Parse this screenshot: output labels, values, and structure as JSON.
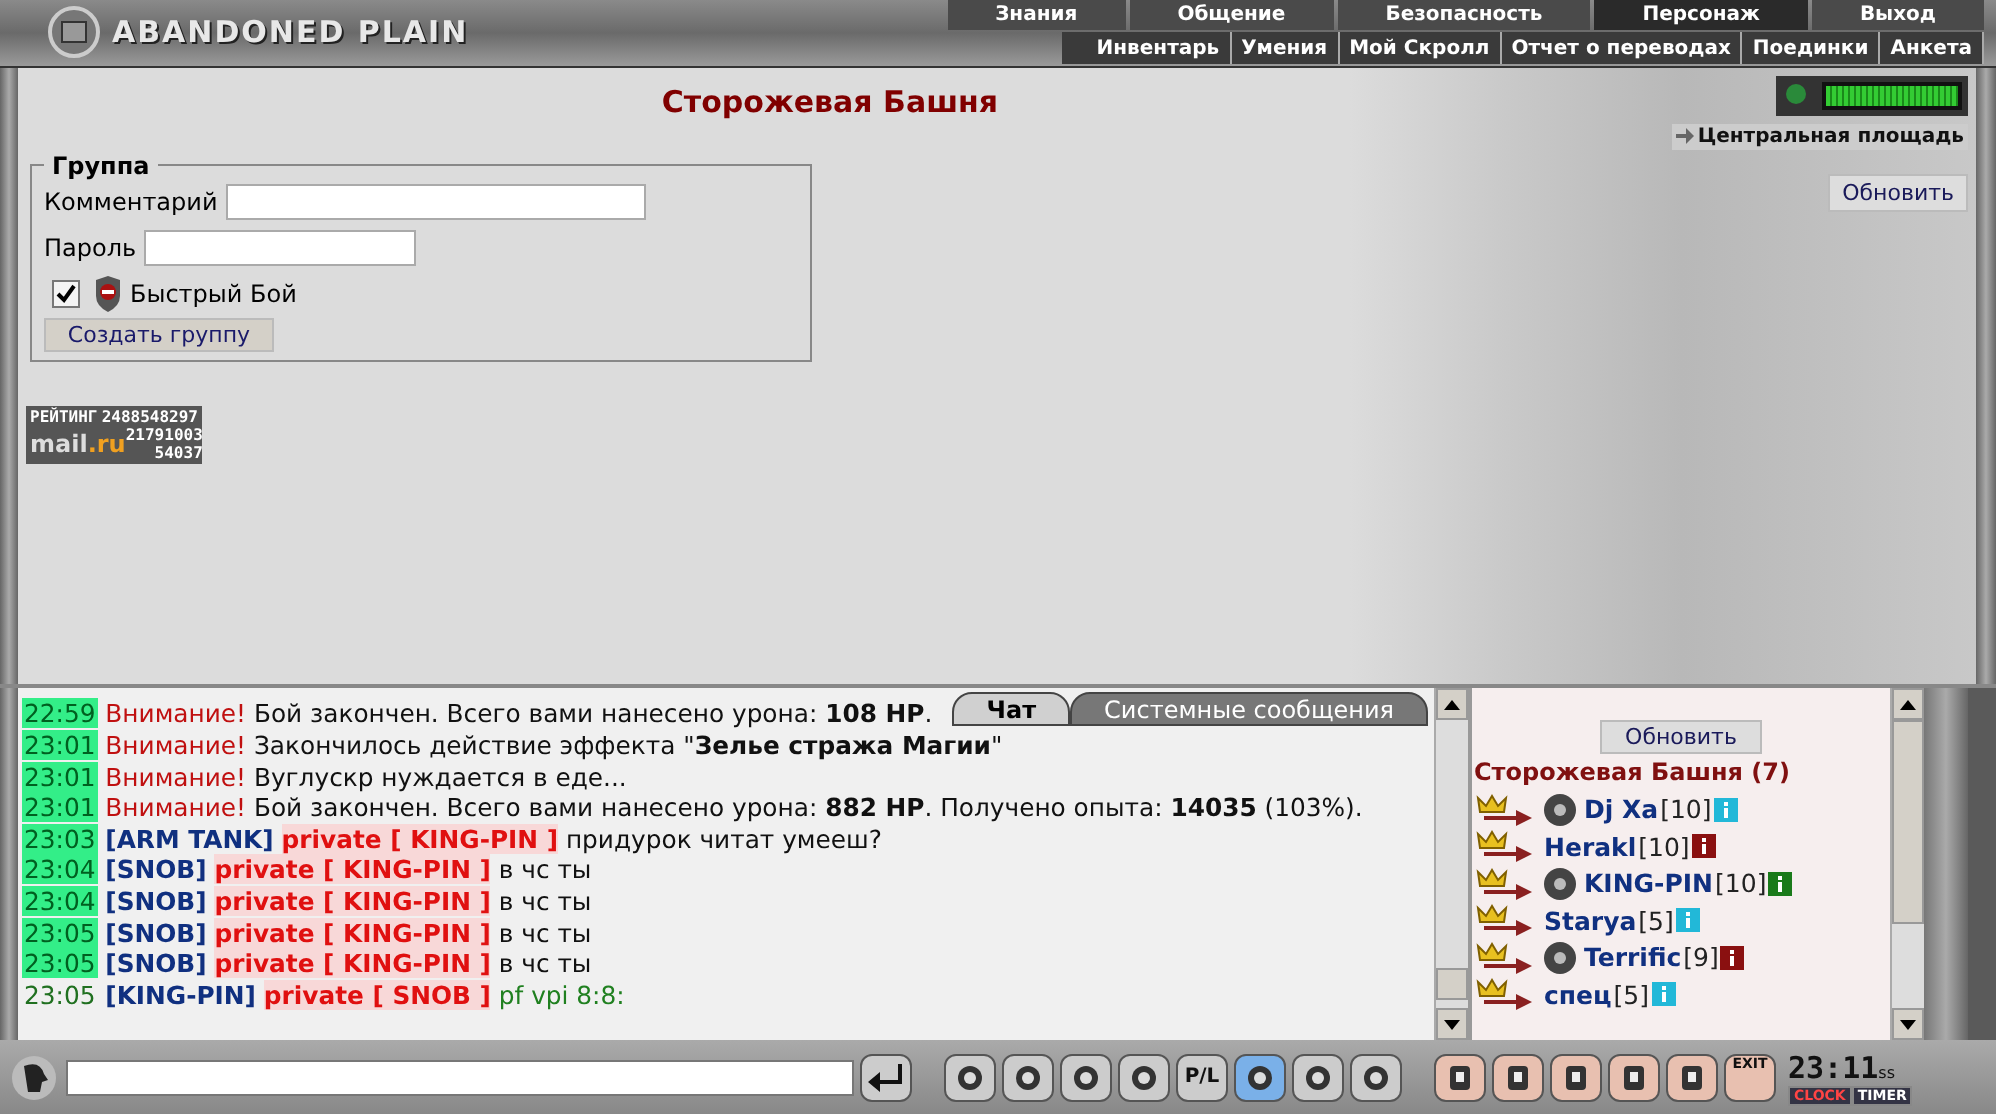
{
  "header": {
    "logo": "ABANDONED PLAIN",
    "menu": [
      {
        "label": "Знания",
        "selected": false
      },
      {
        "label": "Общение",
        "selected": false
      },
      {
        "label": "Безопасность",
        "selected": false
      },
      {
        "label": "Персонаж",
        "selected": true
      },
      {
        "label": "Выход",
        "selected": false
      }
    ],
    "submenu": [
      "Инвентарь",
      "Умения",
      "Мой Скролл",
      "Отчет о переводах",
      "Поединки",
      "Анкета"
    ]
  },
  "page": {
    "title": "Сторожевая Башня",
    "group": {
      "legend": "Группа",
      "fields": [
        {
          "label": "Комментарий"
        },
        {
          "label": "Пароль"
        }
      ],
      "fast_fight": {
        "label": "Быстрый Бой",
        "checked": true
      },
      "create_button": "Создать группу"
    },
    "counter": {
      "label": "РЕЙТИНГ",
      "total": "2488548297",
      "brand": "mail",
      "brand_suffix": ".ru",
      "hits": "21791003",
      "hosts": "54037"
    },
    "energy": {
      "level": 1
    },
    "location": "Центральная площадь",
    "refresh_button": "Обновить"
  },
  "chat": {
    "tabs": [
      {
        "label": "Чат",
        "selected": true
      },
      {
        "label": "Системные сообщения",
        "selected": false
      }
    ],
    "messages": [
      {
        "time": "22:59",
        "kind": "system",
        "label": "Внимание!",
        "text": "Бой закончен. Всего вами нанесено урона: **108 HP**."
      },
      {
        "time": "23:01",
        "kind": "system",
        "label": "Внимание!",
        "text": "Закончилось действие эффекта \"**Зелье стража Магии**\""
      },
      {
        "time": "23:01",
        "kind": "system",
        "label": "Внимание!",
        "text": "Вуглускр нуждается в еде..."
      },
      {
        "time": "23:01",
        "kind": "system",
        "label": "Внимание!",
        "text": "Бой закончен. Всего вами нанесено урона: **882 HP**. Получено опыта: **14035** (103%)."
      },
      {
        "time": "23:03",
        "kind": "private",
        "sender": "[ARM TANK]",
        "target": "private [ KING-PIN ]",
        "text": "придурок читат умееш?"
      },
      {
        "time": "23:04",
        "kind": "private",
        "sender": "[SNOB]",
        "target": "private [ KING-PIN ]",
        "text": "в чс ты"
      },
      {
        "time": "23:04",
        "kind": "private",
        "sender": "[SNOB]",
        "target": "private [ KING-PIN ]",
        "text": "в чс ты"
      },
      {
        "time": "23:05",
        "kind": "private",
        "sender": "[SNOB]",
        "target": "private [ KING-PIN ]",
        "text": "в чс ты"
      },
      {
        "time": "23:05",
        "kind": "private",
        "sender": "[SNOB]",
        "target": "private [ KING-PIN ]",
        "text": "в чс ты"
      },
      {
        "time": "23:05",
        "kind": "outgoing",
        "sender": "[KING-PIN]",
        "target": "private [ SNOB ]",
        "text": "pf vpi 8:8:"
      }
    ]
  },
  "users": {
    "refresh_button": "Обновить",
    "title": "Сторожевая Башня (7)",
    "items": [
      {
        "name": "Dj Xa",
        "level": "[10]",
        "avatar": true,
        "color": "#22b8d8"
      },
      {
        "name": "Herakl",
        "level": "[10]",
        "avatar": false,
        "color": "#8a1010"
      },
      {
        "name": "KING-PIN",
        "level": "[10]",
        "avatar": true,
        "color": "#1a7a1a"
      },
      {
        "name": "Starya",
        "level": "[5]",
        "avatar": false,
        "color": "#22b8d8"
      },
      {
        "name": "Terrific",
        "level": "[9]",
        "avatar": true,
        "color": "#8a1010"
      },
      {
        "name": "спец",
        "level": "[5]",
        "avatar": false,
        "color": "#22b8d8"
      }
    ]
  },
  "toolbar": {
    "pl_label": "P/L",
    "exit_label": "EXIT",
    "clock": "23:11",
    "seconds": "ss",
    "clock_label": "CLOCK",
    "timer_label": "TIMER"
  }
}
